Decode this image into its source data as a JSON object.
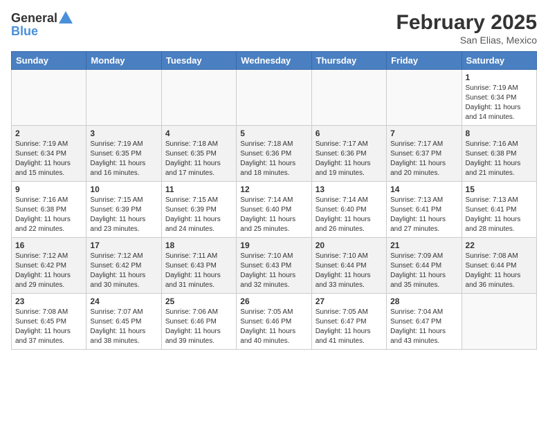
{
  "header": {
    "logo_general": "General",
    "logo_blue": "Blue",
    "month": "February 2025",
    "location": "San Elias, Mexico"
  },
  "weekdays": [
    "Sunday",
    "Monday",
    "Tuesday",
    "Wednesday",
    "Thursday",
    "Friday",
    "Saturday"
  ],
  "weeks": [
    [
      {
        "day": "",
        "info": ""
      },
      {
        "day": "",
        "info": ""
      },
      {
        "day": "",
        "info": ""
      },
      {
        "day": "",
        "info": ""
      },
      {
        "day": "",
        "info": ""
      },
      {
        "day": "",
        "info": ""
      },
      {
        "day": "1",
        "info": "Sunrise: 7:19 AM\nSunset: 6:34 PM\nDaylight: 11 hours and 14 minutes."
      }
    ],
    [
      {
        "day": "2",
        "info": "Sunrise: 7:19 AM\nSunset: 6:34 PM\nDaylight: 11 hours and 15 minutes."
      },
      {
        "day": "3",
        "info": "Sunrise: 7:19 AM\nSunset: 6:35 PM\nDaylight: 11 hours and 16 minutes."
      },
      {
        "day": "4",
        "info": "Sunrise: 7:18 AM\nSunset: 6:35 PM\nDaylight: 11 hours and 17 minutes."
      },
      {
        "day": "5",
        "info": "Sunrise: 7:18 AM\nSunset: 6:36 PM\nDaylight: 11 hours and 18 minutes."
      },
      {
        "day": "6",
        "info": "Sunrise: 7:17 AM\nSunset: 6:36 PM\nDaylight: 11 hours and 19 minutes."
      },
      {
        "day": "7",
        "info": "Sunrise: 7:17 AM\nSunset: 6:37 PM\nDaylight: 11 hours and 20 minutes."
      },
      {
        "day": "8",
        "info": "Sunrise: 7:16 AM\nSunset: 6:38 PM\nDaylight: 11 hours and 21 minutes."
      }
    ],
    [
      {
        "day": "9",
        "info": "Sunrise: 7:16 AM\nSunset: 6:38 PM\nDaylight: 11 hours and 22 minutes."
      },
      {
        "day": "10",
        "info": "Sunrise: 7:15 AM\nSunset: 6:39 PM\nDaylight: 11 hours and 23 minutes."
      },
      {
        "day": "11",
        "info": "Sunrise: 7:15 AM\nSunset: 6:39 PM\nDaylight: 11 hours and 24 minutes."
      },
      {
        "day": "12",
        "info": "Sunrise: 7:14 AM\nSunset: 6:40 PM\nDaylight: 11 hours and 25 minutes."
      },
      {
        "day": "13",
        "info": "Sunrise: 7:14 AM\nSunset: 6:40 PM\nDaylight: 11 hours and 26 minutes."
      },
      {
        "day": "14",
        "info": "Sunrise: 7:13 AM\nSunset: 6:41 PM\nDaylight: 11 hours and 27 minutes."
      },
      {
        "day": "15",
        "info": "Sunrise: 7:13 AM\nSunset: 6:41 PM\nDaylight: 11 hours and 28 minutes."
      }
    ],
    [
      {
        "day": "16",
        "info": "Sunrise: 7:12 AM\nSunset: 6:42 PM\nDaylight: 11 hours and 29 minutes."
      },
      {
        "day": "17",
        "info": "Sunrise: 7:12 AM\nSunset: 6:42 PM\nDaylight: 11 hours and 30 minutes."
      },
      {
        "day": "18",
        "info": "Sunrise: 7:11 AM\nSunset: 6:43 PM\nDaylight: 11 hours and 31 minutes."
      },
      {
        "day": "19",
        "info": "Sunrise: 7:10 AM\nSunset: 6:43 PM\nDaylight: 11 hours and 32 minutes."
      },
      {
        "day": "20",
        "info": "Sunrise: 7:10 AM\nSunset: 6:44 PM\nDaylight: 11 hours and 33 minutes."
      },
      {
        "day": "21",
        "info": "Sunrise: 7:09 AM\nSunset: 6:44 PM\nDaylight: 11 hours and 35 minutes."
      },
      {
        "day": "22",
        "info": "Sunrise: 7:08 AM\nSunset: 6:44 PM\nDaylight: 11 hours and 36 minutes."
      }
    ],
    [
      {
        "day": "23",
        "info": "Sunrise: 7:08 AM\nSunset: 6:45 PM\nDaylight: 11 hours and 37 minutes."
      },
      {
        "day": "24",
        "info": "Sunrise: 7:07 AM\nSunset: 6:45 PM\nDaylight: 11 hours and 38 minutes."
      },
      {
        "day": "25",
        "info": "Sunrise: 7:06 AM\nSunset: 6:46 PM\nDaylight: 11 hours and 39 minutes."
      },
      {
        "day": "26",
        "info": "Sunrise: 7:05 AM\nSunset: 6:46 PM\nDaylight: 11 hours and 40 minutes."
      },
      {
        "day": "27",
        "info": "Sunrise: 7:05 AM\nSunset: 6:47 PM\nDaylight: 11 hours and 41 minutes."
      },
      {
        "day": "28",
        "info": "Sunrise: 7:04 AM\nSunset: 6:47 PM\nDaylight: 11 hours and 43 minutes."
      },
      {
        "day": "",
        "info": ""
      }
    ]
  ]
}
